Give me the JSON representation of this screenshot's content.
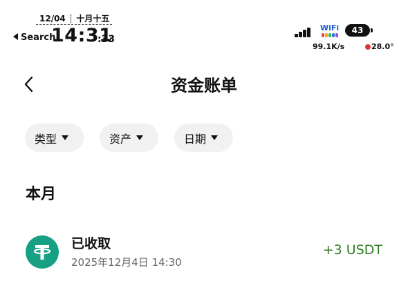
{
  "status_bar": {
    "date": "12/04 ┊ 十月十五",
    "back_app": "Search",
    "time": "14:31",
    "seconds": ":33",
    "wifi_label": "WiFi",
    "battery": "43",
    "net_speed": "99.1K/s",
    "temperature": "28.0°"
  },
  "header": {
    "title": "资金账单",
    "back_icon": "chevron-left-icon"
  },
  "filters": [
    {
      "label": "类型"
    },
    {
      "label": "资产"
    },
    {
      "label": "日期"
    }
  ],
  "section": {
    "title": "本月"
  },
  "transactions": [
    {
      "title": "已收取",
      "time": "2025年12月4日 14:30",
      "amount": "+3 USDT",
      "icon": "tether-icon"
    }
  ],
  "colors": {
    "amount_positive": "#2f7a22",
    "token_bg": "#17a084",
    "chip_bg": "#f1f1f1",
    "wifi_label": "#1a5ad8"
  }
}
